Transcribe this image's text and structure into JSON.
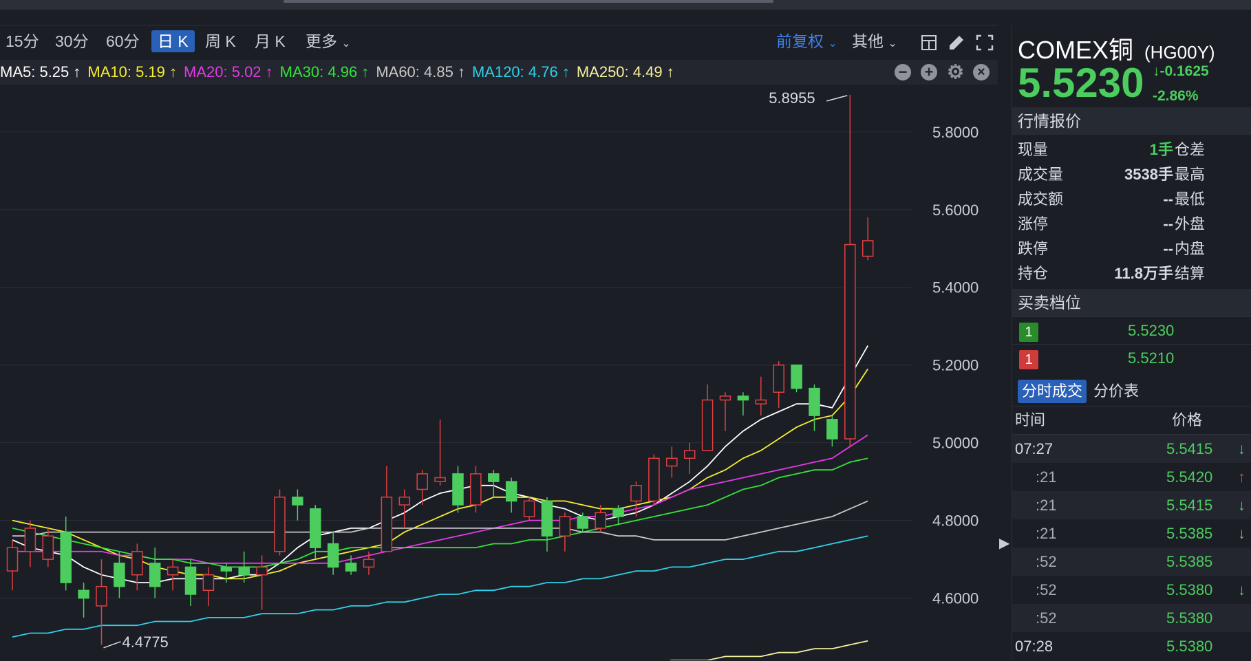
{
  "toolbar": {
    "periods": [
      "15分",
      "30分",
      "60分",
      "日 K",
      "周 K",
      "月 K",
      "更多"
    ],
    "active_period": "日 K",
    "adjust_label": "前复权",
    "other_label": "其他"
  },
  "ma_legend": [
    {
      "label": "MA5: 5.25",
      "color": "#ffffff"
    },
    {
      "label": "MA10: 5.19",
      "color": "#f7ef2f"
    },
    {
      "label": "MA20: 5.02",
      "color": "#e33ae6"
    },
    {
      "label": "MA30: 4.96",
      "color": "#34e43a"
    },
    {
      "label": "MA60: 4.85",
      "color": "#c8c8c8"
    },
    {
      "label": "MA120: 4.76",
      "color": "#2fd1ea"
    },
    {
      "label": "MA250: 4.49",
      "color": "#f6f29e"
    }
  ],
  "ma_arrow": "↑",
  "chart": {
    "y_ticks": [
      "5.8000",
      "5.6000",
      "5.4000",
      "5.2000",
      "5.0000",
      "4.8000",
      "4.6000"
    ],
    "high_label": "5.8955",
    "low_label": "4.4775"
  },
  "chart_data": {
    "type": "candlestick",
    "ylim": [
      4.44,
      5.92
    ],
    "y_ticks": [
      5.8,
      5.6,
      5.4,
      5.2,
      5.0,
      4.8,
      4.6
    ],
    "annotations": [
      {
        "text": "5.8955",
        "value": 5.8955
      },
      {
        "text": "4.4775",
        "value": 4.4775
      }
    ],
    "candles": [
      [
        4.67,
        4.73,
        4.62,
        4.75
      ],
      [
        4.72,
        4.78,
        4.68,
        4.8
      ],
      [
        4.7,
        4.76,
        4.68,
        4.78
      ],
      [
        4.77,
        4.64,
        4.62,
        4.81
      ],
      [
        4.62,
        4.6,
        4.55,
        4.64
      ],
      [
        4.58,
        4.63,
        4.48,
        4.7
      ],
      [
        4.69,
        4.63,
        4.6,
        4.72
      ],
      [
        4.66,
        4.72,
        4.62,
        4.74
      ],
      [
        4.69,
        4.63,
        4.6,
        4.73
      ],
      [
        4.66,
        4.68,
        4.62,
        4.7
      ],
      [
        4.68,
        4.61,
        4.58,
        4.7
      ],
      [
        4.62,
        4.66,
        4.58,
        4.68
      ],
      [
        4.68,
        4.67,
        4.64,
        4.69
      ],
      [
        4.68,
        4.66,
        4.64,
        4.72
      ],
      [
        4.66,
        4.68,
        4.57,
        4.71
      ],
      [
        4.72,
        4.86,
        4.71,
        4.88
      ],
      [
        4.86,
        4.84,
        4.8,
        4.88
      ],
      [
        4.83,
        4.73,
        4.7,
        4.84
      ],
      [
        4.74,
        4.68,
        4.66,
        4.77
      ],
      [
        4.69,
        4.67,
        4.66,
        4.71
      ],
      [
        4.68,
        4.7,
        4.66,
        4.72
      ],
      [
        4.72,
        4.86,
        4.72,
        4.94
      ],
      [
        4.84,
        4.86,
        4.78,
        4.88
      ],
      [
        4.88,
        4.92,
        4.84,
        4.93
      ],
      [
        4.9,
        4.91,
        4.89,
        5.06
      ],
      [
        4.92,
        4.84,
        4.82,
        4.94
      ],
      [
        4.84,
        4.92,
        4.82,
        4.94
      ],
      [
        4.92,
        4.9,
        4.86,
        4.93
      ],
      [
        4.9,
        4.85,
        4.82,
        4.91
      ],
      [
        4.81,
        4.85,
        4.8,
        4.86
      ],
      [
        4.85,
        4.76,
        4.72,
        4.86
      ],
      [
        4.76,
        4.81,
        4.72,
        4.82
      ],
      [
        4.81,
        4.78,
        4.77,
        4.82
      ],
      [
        4.78,
        4.82,
        4.77,
        4.84
      ],
      [
        4.83,
        4.81,
        4.79,
        4.84
      ],
      [
        4.85,
        4.89,
        4.81,
        4.9
      ],
      [
        4.85,
        4.96,
        4.84,
        4.97
      ],
      [
        4.94,
        4.96,
        4.91,
        4.99
      ],
      [
        4.96,
        4.98,
        4.92,
        5.0
      ],
      [
        4.98,
        5.11,
        4.98,
        5.15
      ],
      [
        5.11,
        5.12,
        5.03,
        5.13
      ],
      [
        5.12,
        5.11,
        5.07,
        5.13
      ],
      [
        5.1,
        5.11,
        5.07,
        5.17
      ],
      [
        5.13,
        5.2,
        5.09,
        5.21
      ],
      [
        5.2,
        5.14,
        5.13,
        5.2
      ],
      [
        5.14,
        5.07,
        5.03,
        5.15
      ],
      [
        5.06,
        5.01,
        4.99,
        5.07
      ],
      [
        5.01,
        5.51,
        4.99,
        5.8955
      ],
      [
        5.48,
        5.52,
        5.47,
        5.58
      ]
    ],
    "series": [
      {
        "name": "MA5",
        "values": [
          4.75,
          4.73,
          4.72,
          4.71,
          4.68,
          4.66,
          4.65,
          4.64,
          4.64,
          4.65,
          4.65,
          4.65,
          4.65,
          4.66,
          4.66,
          4.69,
          4.73,
          4.76,
          4.77,
          4.78,
          4.78,
          4.8,
          4.82,
          4.85,
          4.87,
          4.88,
          4.89,
          4.89,
          4.87,
          4.86,
          4.84,
          4.83,
          4.81,
          4.8,
          4.81,
          4.82,
          4.84,
          4.87,
          4.9,
          4.94,
          4.99,
          5.03,
          5.06,
          5.08,
          5.1,
          5.1,
          5.09,
          5.17,
          5.25
        ]
      },
      {
        "name": "MA10",
        "values": [
          4.8,
          4.79,
          4.78,
          4.77,
          4.75,
          4.73,
          4.71,
          4.7,
          4.68,
          4.67,
          4.66,
          4.66,
          4.65,
          4.65,
          4.66,
          4.67,
          4.69,
          4.7,
          4.71,
          4.72,
          4.73,
          4.74,
          4.77,
          4.79,
          4.81,
          4.83,
          4.84,
          4.86,
          4.86,
          4.86,
          4.85,
          4.85,
          4.84,
          4.83,
          4.83,
          4.84,
          4.85,
          4.86,
          4.88,
          4.91,
          4.93,
          4.96,
          4.98,
          5.01,
          5.04,
          5.06,
          5.07,
          5.12,
          5.19
        ]
      },
      {
        "name": "MA20",
        "values": [
          4.72,
          4.72,
          4.72,
          4.72,
          4.72,
          4.72,
          4.71,
          4.71,
          4.7,
          4.7,
          4.7,
          4.69,
          4.69,
          4.69,
          4.69,
          4.69,
          4.69,
          4.69,
          4.69,
          4.7,
          4.71,
          4.72,
          4.73,
          4.74,
          4.75,
          4.76,
          4.77,
          4.78,
          4.79,
          4.8,
          4.8,
          4.8,
          4.81,
          4.81,
          4.82,
          4.83,
          4.84,
          4.86,
          4.88,
          4.89,
          4.9,
          4.91,
          4.92,
          4.93,
          4.94,
          4.95,
          4.96,
          4.99,
          5.02
        ]
      },
      {
        "name": "MA30",
        "values": [
          4.78,
          4.77,
          4.76,
          4.75,
          4.74,
          4.73,
          4.72,
          4.71,
          4.7,
          4.7,
          4.69,
          4.69,
          4.68,
          4.68,
          4.68,
          4.69,
          4.7,
          4.72,
          4.72,
          4.73,
          4.73,
          4.73,
          4.73,
          4.73,
          4.73,
          4.73,
          4.73,
          4.74,
          4.74,
          4.75,
          4.75,
          4.76,
          4.77,
          4.78,
          4.79,
          4.8,
          4.81,
          4.82,
          4.83,
          4.84,
          4.86,
          4.88,
          4.89,
          4.91,
          4.92,
          4.93,
          4.93,
          4.95,
          4.96
        ]
      },
      {
        "name": "MA60",
        "values": [
          4.76,
          4.76,
          4.77,
          4.77,
          4.77,
          4.77,
          4.77,
          4.77,
          4.77,
          4.77,
          4.77,
          4.77,
          4.77,
          4.77,
          4.77,
          4.77,
          4.77,
          4.77,
          4.77,
          4.77,
          4.78,
          4.78,
          4.78,
          4.78,
          4.78,
          4.78,
          4.78,
          4.78,
          4.78,
          4.78,
          4.78,
          4.78,
          4.77,
          4.77,
          4.76,
          4.76,
          4.75,
          4.75,
          4.75,
          4.75,
          4.75,
          4.76,
          4.77,
          4.78,
          4.79,
          4.8,
          4.81,
          4.83,
          4.85
        ]
      },
      {
        "name": "MA120",
        "values": [
          4.5,
          4.51,
          4.51,
          4.52,
          4.52,
          4.53,
          4.53,
          4.53,
          4.54,
          4.54,
          4.54,
          4.55,
          4.55,
          4.55,
          4.56,
          4.56,
          4.56,
          4.57,
          4.57,
          4.58,
          4.58,
          4.59,
          4.59,
          4.6,
          4.61,
          4.61,
          4.62,
          4.62,
          4.63,
          4.63,
          4.64,
          4.64,
          4.65,
          4.65,
          4.66,
          4.67,
          4.67,
          4.68,
          4.68,
          4.69,
          4.7,
          4.7,
          4.71,
          4.72,
          4.72,
          4.73,
          4.74,
          4.75,
          4.76
        ]
      },
      {
        "name": "MA250",
        "values": [
          null,
          null,
          null,
          null,
          null,
          null,
          null,
          null,
          null,
          null,
          null,
          null,
          null,
          null,
          null,
          null,
          null,
          null,
          null,
          null,
          null,
          null,
          null,
          null,
          null,
          null,
          4.41,
          4.41,
          4.41,
          4.42,
          4.42,
          4.42,
          4.42,
          4.43,
          4.43,
          4.43,
          4.43,
          4.44,
          4.44,
          4.44,
          4.45,
          4.45,
          4.45,
          4.46,
          4.46,
          4.47,
          4.47,
          4.48,
          4.49
        ]
      }
    ]
  },
  "side": {
    "name": "COMEX铜",
    "code": "(HG00Y)",
    "price": "5.5230",
    "change": "-0.1625",
    "change_pct": "-2.86%",
    "change_arrow": "↓",
    "quote_header": "行情报价",
    "quotes": [
      {
        "label": "现量",
        "value": "1手",
        "label2": "仓差",
        "value_color": "#4ccd5e"
      },
      {
        "label": "成交量",
        "value": "3538手",
        "label2": "最高",
        "value_color": "#d8dbe2"
      },
      {
        "label": "成交额",
        "value": "--",
        "label2": "最低",
        "value_color": "#d8dbe2"
      },
      {
        "label": "涨停",
        "value": "--",
        "label2": "外盘",
        "value_color": "#d8dbe2"
      },
      {
        "label": "跌停",
        "value": "--",
        "label2": "内盘",
        "value_color": "#d8dbe2"
      },
      {
        "label": "持仓",
        "value": "11.8万手",
        "label2": "结算",
        "value_color": "#d8dbe2"
      }
    ],
    "orderbook_header": "买卖档位",
    "orderbook": [
      {
        "level": "1",
        "price": "5.5230",
        "badge_color": "#2a8b2a"
      },
      {
        "level": "1",
        "price": "5.5210",
        "badge_color": "#d03a3a"
      }
    ],
    "tab_active": "分时成交",
    "tab_other": "分价表",
    "trade_header_time": "时间",
    "trade_header_price": "价格",
    "trades": [
      {
        "time": "07:27",
        "price": "5.5415",
        "arrow": "↓",
        "arrow_color": "#4ccd5e",
        "sub": false
      },
      {
        "time": ":21",
        "price": "5.5420",
        "arrow": "↑",
        "arrow_color": "#e04040",
        "sub": true
      },
      {
        "time": ":21",
        "price": "5.5415",
        "arrow": "↓",
        "arrow_color": "#4ccd5e",
        "sub": true
      },
      {
        "time": ":21",
        "price": "5.5385",
        "arrow": "↓",
        "arrow_color": "#4ccd5e",
        "sub": true
      },
      {
        "time": ":52",
        "price": "5.5385",
        "arrow": "",
        "arrow_color": "#4ccd5e",
        "sub": true
      },
      {
        "time": ":52",
        "price": "5.5380",
        "arrow": "↓",
        "arrow_color": "#4ccd5e",
        "sub": true
      },
      {
        "time": ":52",
        "price": "5.5380",
        "arrow": "",
        "arrow_color": "#4ccd5e",
        "sub": true
      },
      {
        "time": "07:28",
        "price": "5.5380",
        "arrow": "",
        "arrow_color": "#4ccd5e",
        "sub": false
      }
    ]
  },
  "colors": {
    "up": "#e04040",
    "down": "#4ccd5e",
    "accent": "#2960b8"
  }
}
